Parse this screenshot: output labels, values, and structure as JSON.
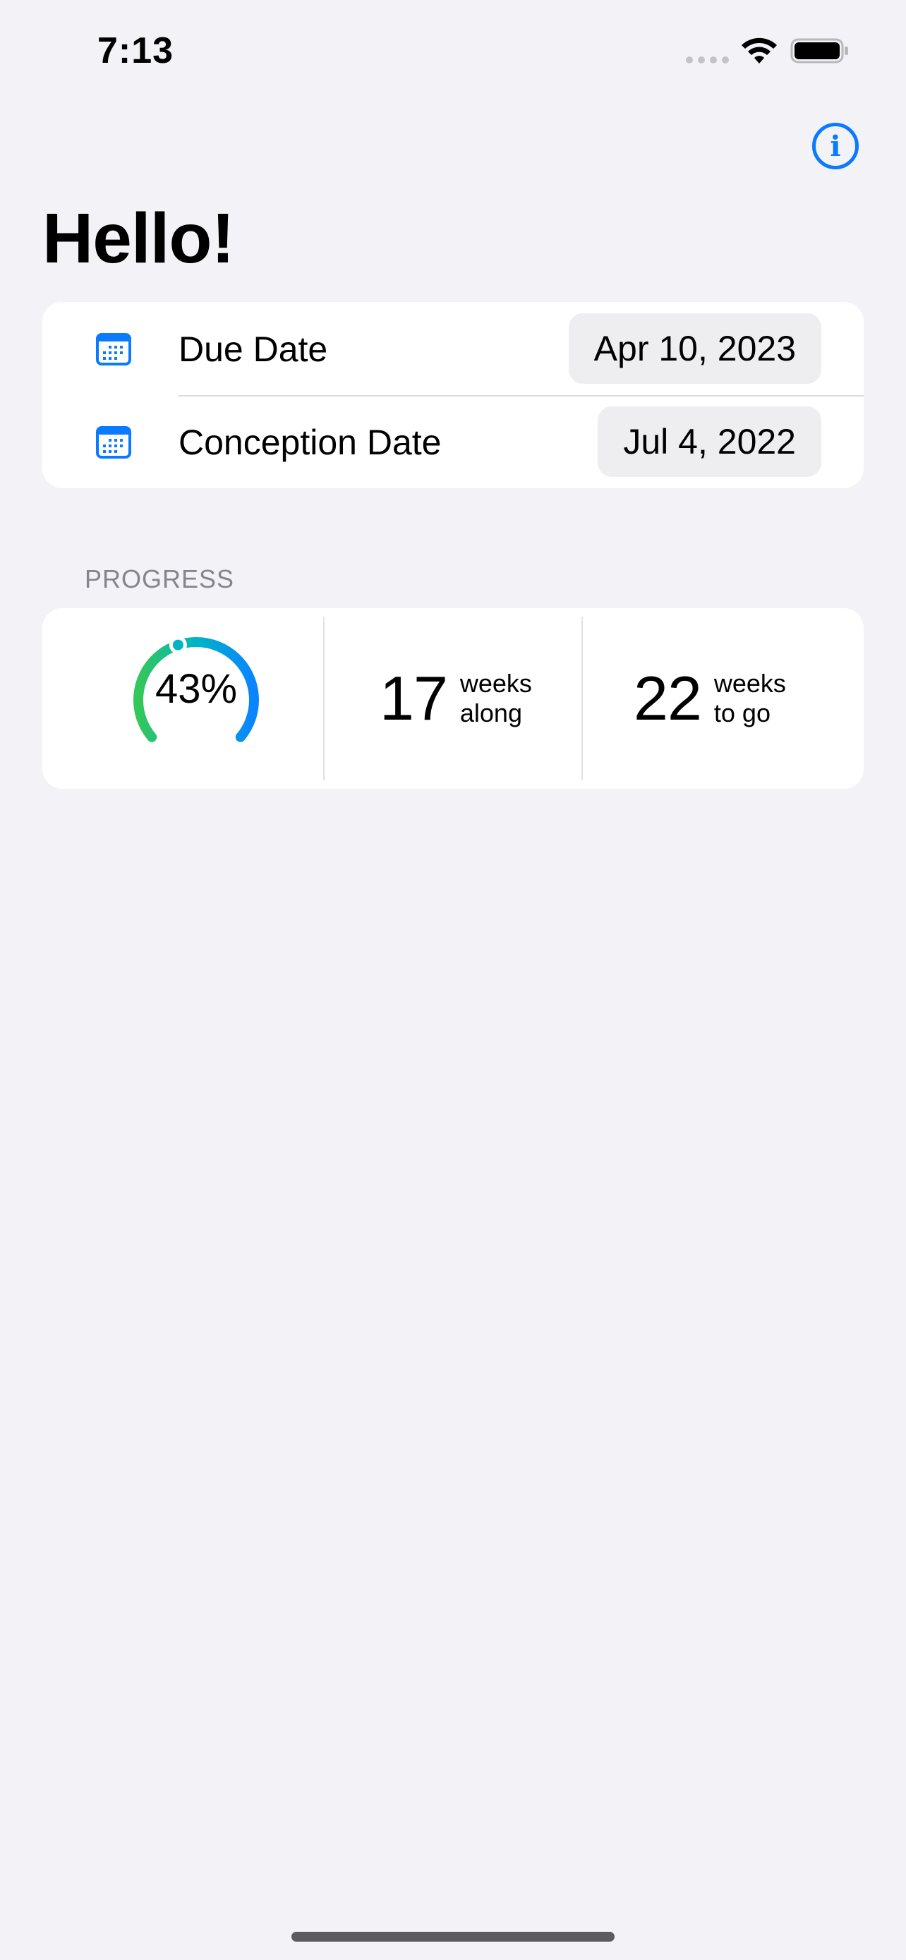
{
  "status_bar": {
    "time": "7:13",
    "icons": [
      "cellular-signal-icon",
      "wifi-icon",
      "battery-icon"
    ]
  },
  "header": {
    "info_icon": "info-circle-icon",
    "info_glyph": "i",
    "title": "Hello!"
  },
  "dates": [
    {
      "icon": "calendar-icon",
      "label": "Due Date",
      "value": "Apr 10, 2023"
    },
    {
      "icon": "calendar-icon",
      "label": "Conception Date",
      "value": "Jul 4, 2022"
    }
  ],
  "progress": {
    "section_title": "PROGRESS",
    "percent_label": "43%",
    "percent_fraction": 0.43,
    "weeks_along": {
      "number": "17",
      "unit_line1": "weeks",
      "unit_line2": "along"
    },
    "weeks_to_go": {
      "number": "22",
      "unit_line1": "weeks",
      "unit_line2": "to go"
    }
  },
  "colors": {
    "accent": "#0a7aff",
    "gauge_start": "#34c759",
    "gauge_mid": "#00b4c6",
    "gauge_end": "#0a84ff",
    "background": "#f2f2f7"
  }
}
